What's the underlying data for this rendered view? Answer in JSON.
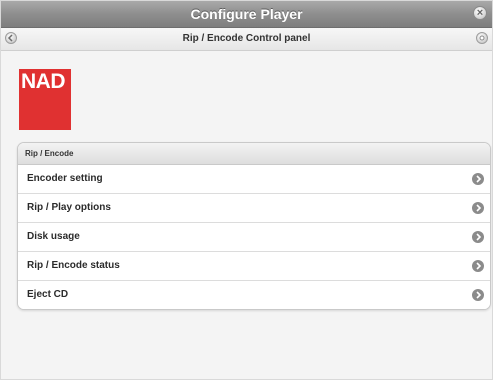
{
  "window": {
    "title": "Configure Player",
    "close_icon": "close-icon"
  },
  "navbar": {
    "title": "Rip / Encode Control panel",
    "back_icon": "circle-back-icon",
    "menu_icon": "circle-icon"
  },
  "logo": {
    "text": "NAD",
    "color": "#e03131"
  },
  "panel": {
    "header": "Rip / Encode",
    "items": [
      {
        "label": "Encoder setting"
      },
      {
        "label": "Rip / Play options"
      },
      {
        "label": "Disk usage"
      },
      {
        "label": "Rip / Encode status"
      },
      {
        "label": "Eject CD"
      }
    ]
  }
}
